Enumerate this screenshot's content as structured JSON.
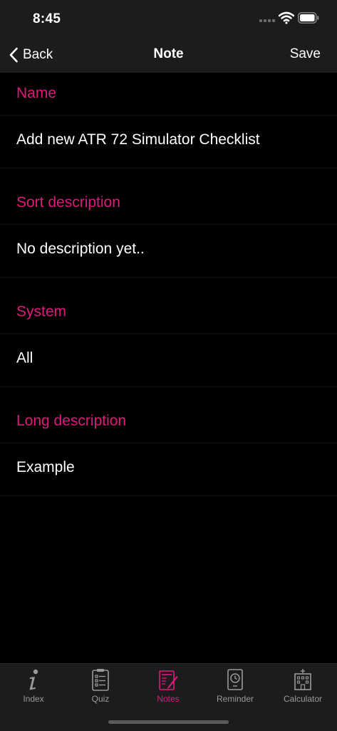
{
  "status_bar": {
    "time": "8:45"
  },
  "nav": {
    "back_label": "Back",
    "title": "Note",
    "save_label": "Save"
  },
  "form": {
    "sections": [
      {
        "header": "Name",
        "value": "Add new ATR 72 Simulator Checklist"
      },
      {
        "header": "Sort description",
        "value": "No description yet.."
      },
      {
        "header": "System",
        "value": "All"
      },
      {
        "header": "Long description",
        "value": "Example"
      }
    ]
  },
  "tab_bar": {
    "tabs": [
      {
        "label": "Index",
        "icon": "info-icon"
      },
      {
        "label": "Quiz",
        "icon": "clipboard-icon"
      },
      {
        "label": "Notes",
        "icon": "notes-icon",
        "active": true
      },
      {
        "label": "Reminder",
        "icon": "clock-icon"
      },
      {
        "label": "Calculator",
        "icon": "building-icon"
      }
    ]
  },
  "colors": {
    "accent": "#e0197d",
    "background": "#000000",
    "bar": "#1c1c1e",
    "inactive": "#9a9a9a"
  }
}
